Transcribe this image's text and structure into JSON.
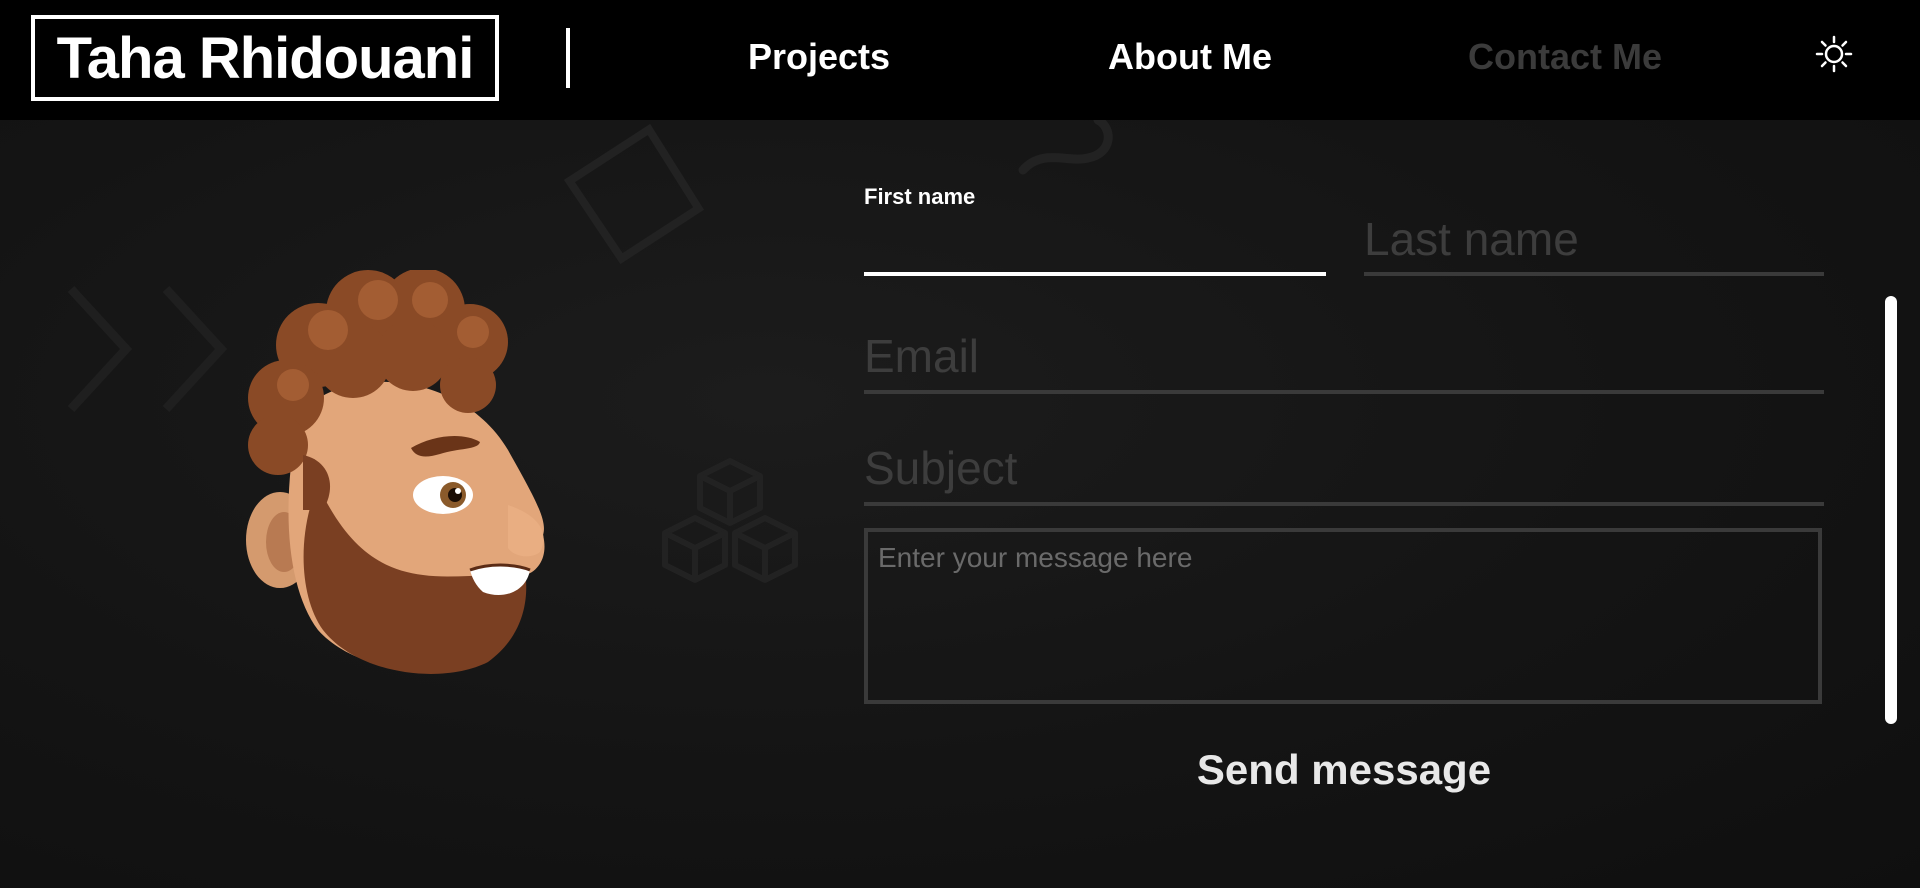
{
  "header": {
    "logo_text": "Taha Rhidouani",
    "nav": {
      "projects": "Projects",
      "about": "About Me",
      "contact": "Contact Me"
    },
    "theme_toggle_icon": "sun-icon"
  },
  "form": {
    "first_name": {
      "label": "First name",
      "value": ""
    },
    "last_name": {
      "placeholder": "Last name",
      "value": ""
    },
    "email": {
      "placeholder": "Email",
      "value": ""
    },
    "subject": {
      "placeholder": "Subject",
      "value": ""
    },
    "message": {
      "placeholder": "Enter your message here",
      "value": ""
    },
    "send_label": "Send message"
  },
  "colors": {
    "background": "#121212",
    "header": "#000000",
    "text": "#ffffff",
    "inactive_nav": "#3b3b3b",
    "field_border": "#3a3a3a",
    "placeholder": "#3d3d3d"
  }
}
